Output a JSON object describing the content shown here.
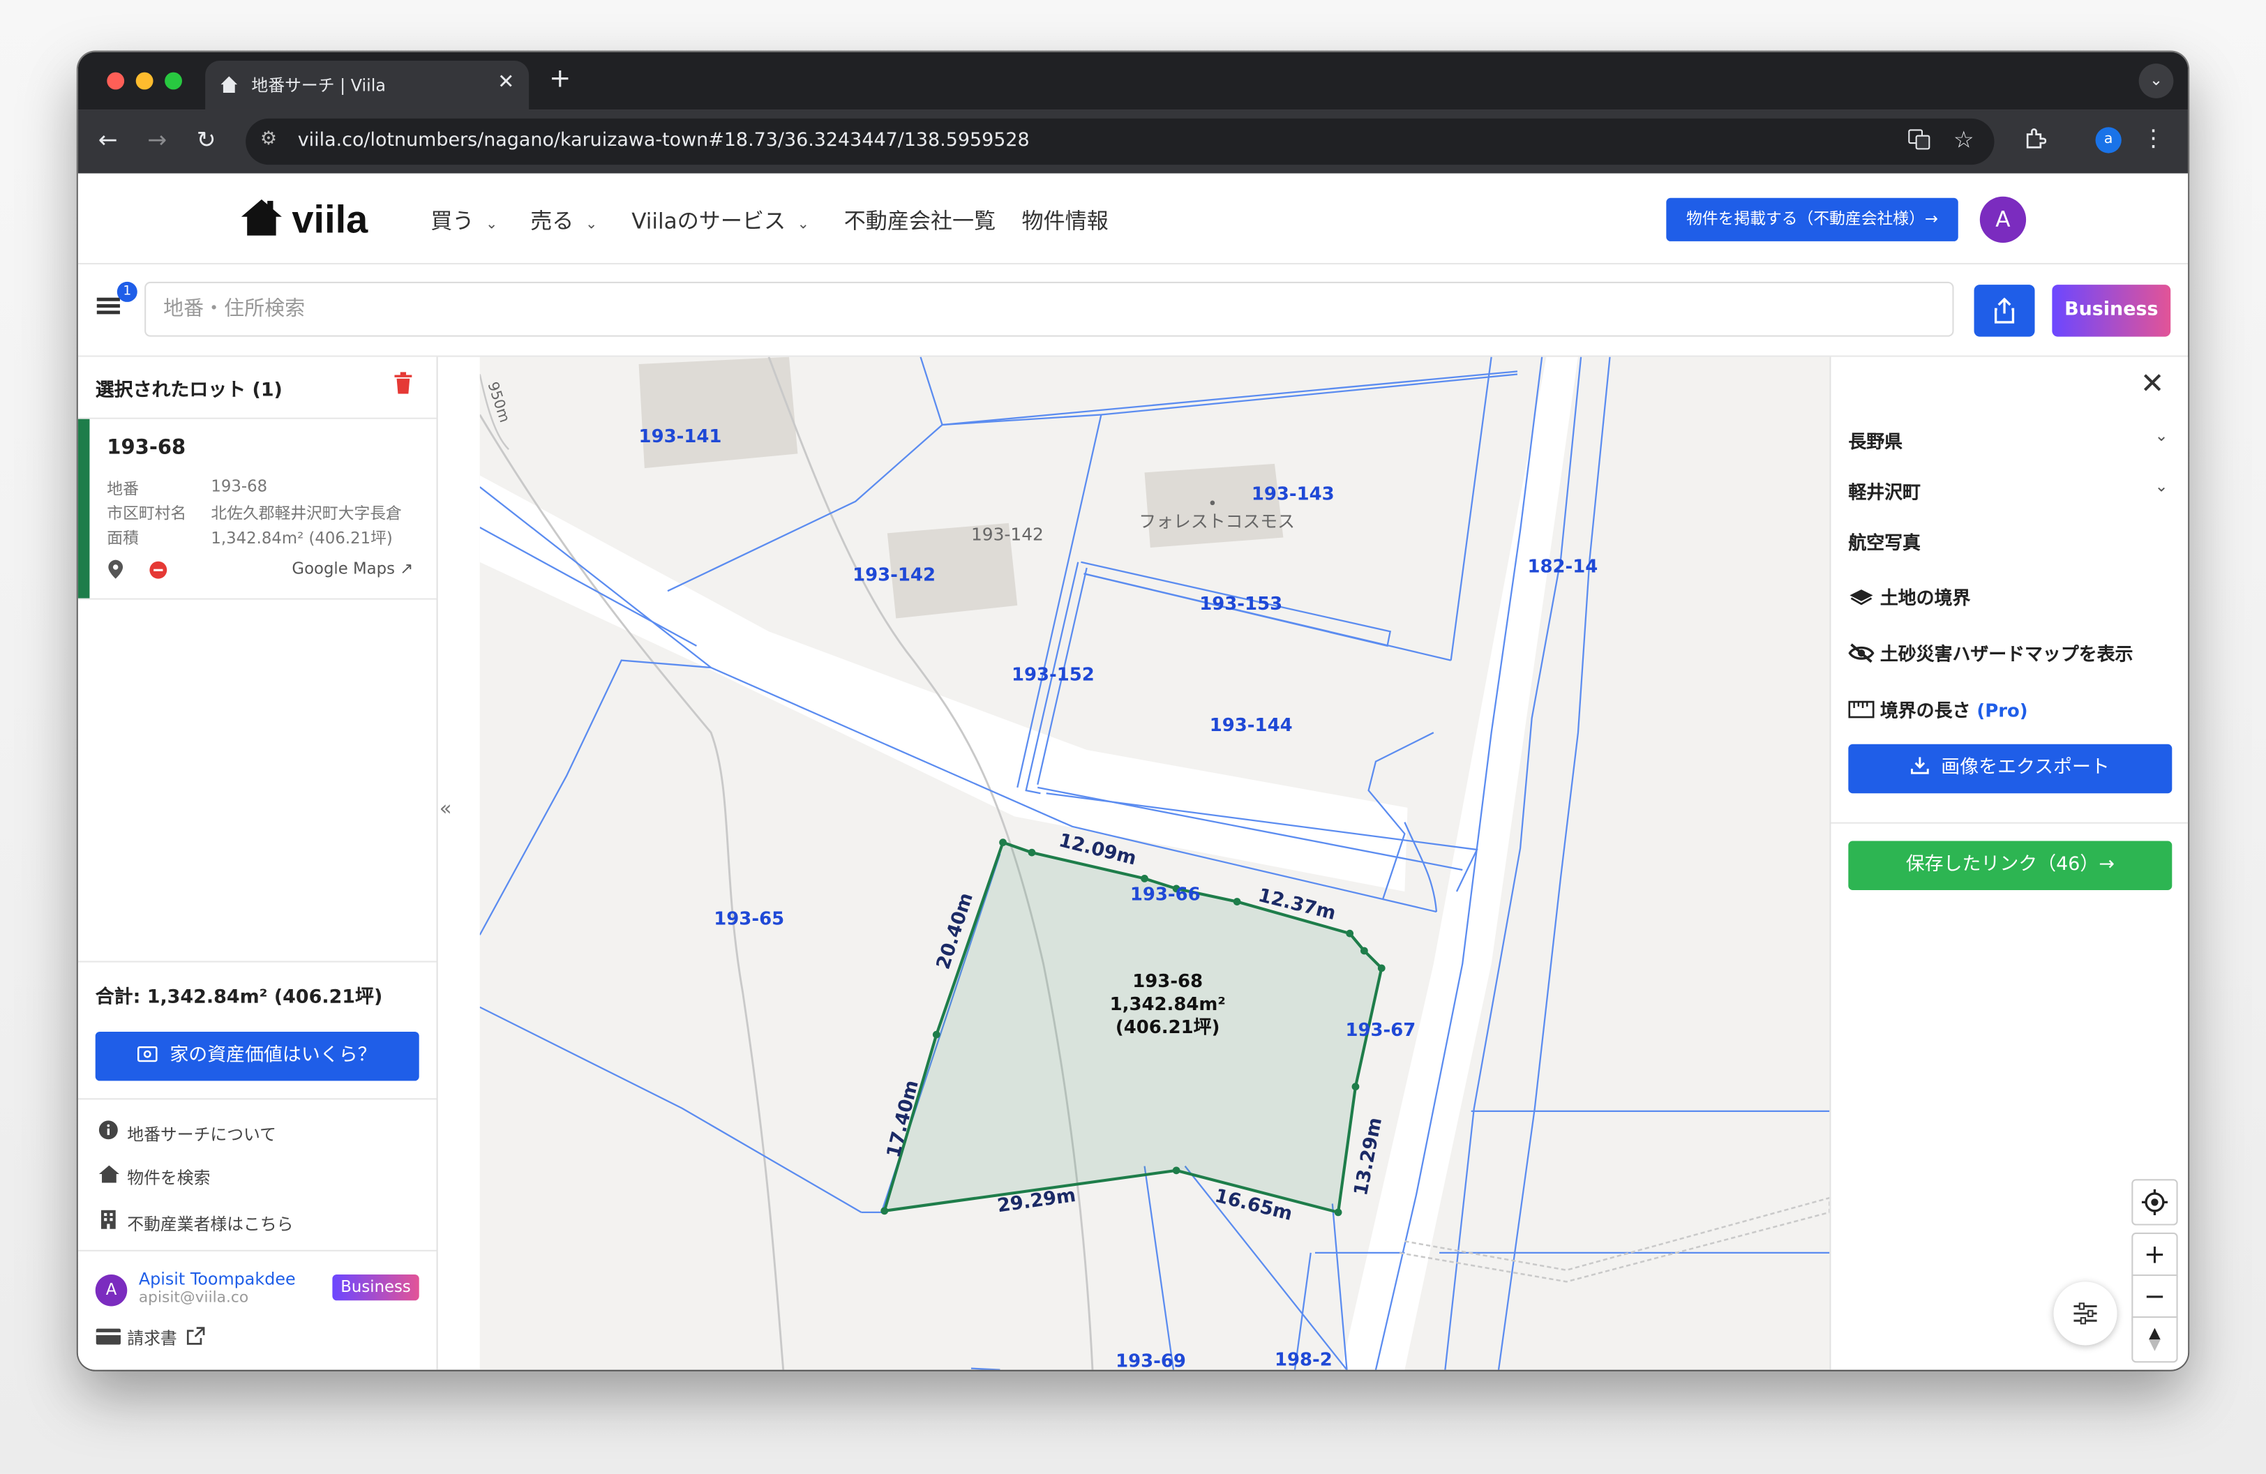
{
  "browser": {
    "tab_title": "地番サーチ | Viila",
    "url": "viila.co/lotnumbers/nagano/karuizawa-town#18.73/36.3243447/138.5959528",
    "profile_initial": "a"
  },
  "header": {
    "logo_text": "viila",
    "nav": {
      "buy": "買う",
      "sell": "売る",
      "services": "Viilaのサービス",
      "agencies": "不動産会社一覧",
      "properties": "物件情報"
    },
    "list_property_button": "物件を掲載する（不動産会社様）→",
    "avatar_initial": "A"
  },
  "search": {
    "badge_count": "1",
    "placeholder": "地番・住所検索",
    "business_button": "Business"
  },
  "left_panel": {
    "title": "選択されたロット (1)",
    "lot": {
      "id": "193-68",
      "fields": [
        {
          "label": "地番",
          "value": "193-68"
        },
        {
          "label": "市区町村名",
          "value": "北佐久郡軽井沢町大字長倉"
        },
        {
          "label": "面積",
          "value": "1,342.84m² (406.21坪)"
        }
      ],
      "google_maps": "Google Maps ↗"
    },
    "total": "合計: 1,342.84m² (406.21坪)",
    "value_button": "家の資産価値はいくら？",
    "links": {
      "about": "地番サーチについて",
      "search_properties": "物件を検索",
      "for_agents": "不動産業者様はこちら"
    },
    "user": {
      "initial": "A",
      "name": "Apisit Toompakdee",
      "email": "apisit@viila.co",
      "badge": "Business"
    },
    "invoice": "請求書"
  },
  "map": {
    "lot_labels": {
      "l193_141": "193-141",
      "l193_142": "193-142",
      "l193_142_grey": "193-142",
      "l193_143": "193-143",
      "l193_152": "193-152",
      "l193_153": "193-153",
      "l193_144": "193-144",
      "l182_14": "182-14",
      "l193_65": "193-65",
      "l193_66": "193-66",
      "l193_67": "193-67",
      "l193_69": "193-69",
      "l198_2": "198-2"
    },
    "poi": "フォレストコスモス",
    "contour": "950m",
    "selected": {
      "id": "193-68",
      "area_m2": "1,342.84m²",
      "area_tsubo": "(406.21坪)"
    },
    "edges": {
      "top": "12.09m",
      "top_right": "12.37m",
      "left_upper": "20.40m",
      "left_lower": "17.40m",
      "bottom_left": "29.29m",
      "bottom_right": "16.65m",
      "right": "13.29m"
    }
  },
  "right_panel": {
    "prefecture": "長野県",
    "town": "軽井沢町",
    "aerial": "航空写真",
    "land_boundary": "土地の境界",
    "hazard_map": "土砂災害ハザードマップを表示",
    "boundary_length": "境界の長さ",
    "pro": "(Pro)",
    "export_button": "画像をエクスポート",
    "saved_links_button": "保存したリンク（46）→"
  },
  "colors": {
    "accent": "#1f5ee8",
    "lot_green": "#1e7d4a",
    "saved_green": "#2db552",
    "boundary_blue": "#5b8cf0"
  }
}
